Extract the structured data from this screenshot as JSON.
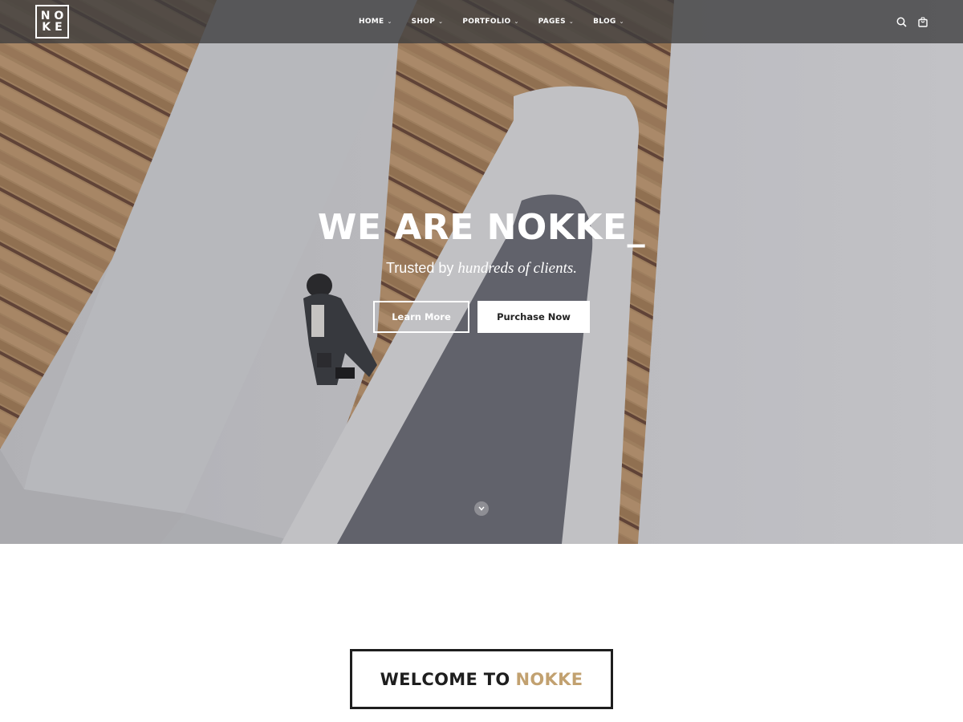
{
  "logo": {
    "line1": "NO",
    "line2": "KE"
  },
  "nav": {
    "items": [
      {
        "label": "HOME",
        "name": "home"
      },
      {
        "label": "SHOP",
        "name": "shop"
      },
      {
        "label": "PORTFOLIO",
        "name": "portfolio"
      },
      {
        "label": "PAGES",
        "name": "pages"
      },
      {
        "label": "BLOG",
        "name": "blog"
      }
    ],
    "dropdown_icon": "chevron-down-icon",
    "icons": [
      "search-icon",
      "shopping-bag-icon"
    ]
  },
  "hero": {
    "title": "WE ARE NOKKE_",
    "subtitle_plain": "Trusted by ",
    "subtitle_emphasis": "hundreds of clients.",
    "learn_more_label": "Learn More",
    "purchase_label": "Purchase Now",
    "scroll_icon": "chevron-down-icon"
  },
  "welcome": {
    "prefix": "WELCOME TO",
    "brand": "NOKKE"
  },
  "colors": {
    "accent": "#c2a170",
    "header_bg": "#3c3c3e",
    "text_dark": "#1e1e1e"
  }
}
